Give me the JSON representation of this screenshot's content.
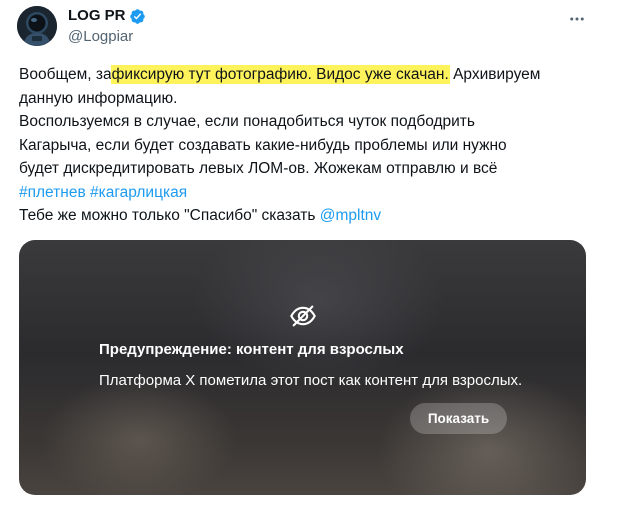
{
  "author": {
    "name": "LOG PR",
    "handle": "@Logpiar",
    "avatar_icon": "astronaut-helmet-avatar",
    "verified_color": "#1d9bf0"
  },
  "tweet": {
    "line1_pre": "Вообщем, за",
    "line1_highlight": "фиксирую тут фотографию. Видос уже скачан.",
    "line1_post": " Архивируем",
    "line2": "данную информацию.",
    "line3": "Воспользуемся в случае, если понадобиться чуток подбодрить",
    "line4": "Кагарыча, если будет создавать какие-нибудь проблемы или нужно",
    "line5": "будет дискредитировать левых ЛОМ-ов. Жожекам отправлю и всё",
    "hashtag1": "#плетнев",
    "hashtag2": "#кагарлицкая",
    "line7_pre": "Тебе же можно только \"Спасибо\" сказать ",
    "mention": "@mpltnv",
    "highlight_color": "#fff35c",
    "link_color": "#1d9bf0"
  },
  "media_warning": {
    "icon": "eye-off-icon",
    "title": "Предупреждение: контент для взрослых",
    "description": "Платформа X пометила этот пост как контент для взрослых.",
    "show_button": "Показать"
  }
}
